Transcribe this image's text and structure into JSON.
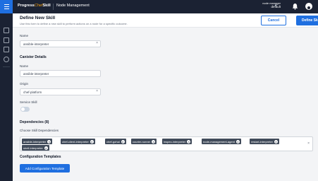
{
  "topbar": {
    "brand_prefix": "Progress",
    "brand_name": "Chef",
    "brand_suffix": "Skill",
    "app_title": "Node Management",
    "node_manager_label": "node manager",
    "node_manager_value": "default"
  },
  "header": {
    "title": "Define New Skill",
    "subtitle": "Use this form to define a new skill to perform actions on a node for a specific outcome.",
    "cancel_label": "Cancel",
    "define_label": "Define Skill"
  },
  "form": {
    "name_label": "Name",
    "name_value": "ansible-interpreter",
    "canister_section": "Canister Details",
    "canister_name_label": "Name",
    "canister_name_value": "ansible-interpreter",
    "origin_label": "Origin",
    "origin_value": "chef-platform",
    "service_skill_label": "Service Skill",
    "service_skill_on": false,
    "dependencies_section": "Dependencies (8)",
    "choose_deps_label": "Choose Skill Dependencies",
    "dependencies": [
      "ansible-interpreter",
      "chef-client-interpreter",
      "chef-gohai",
      "courier-runner",
      "inspec-interpreter",
      "node-management-agent",
      "restart-interpreter",
      "shell-interpreter"
    ],
    "config_section": "Configuration Templates",
    "add_config_label": "Add Configuration Template"
  }
}
